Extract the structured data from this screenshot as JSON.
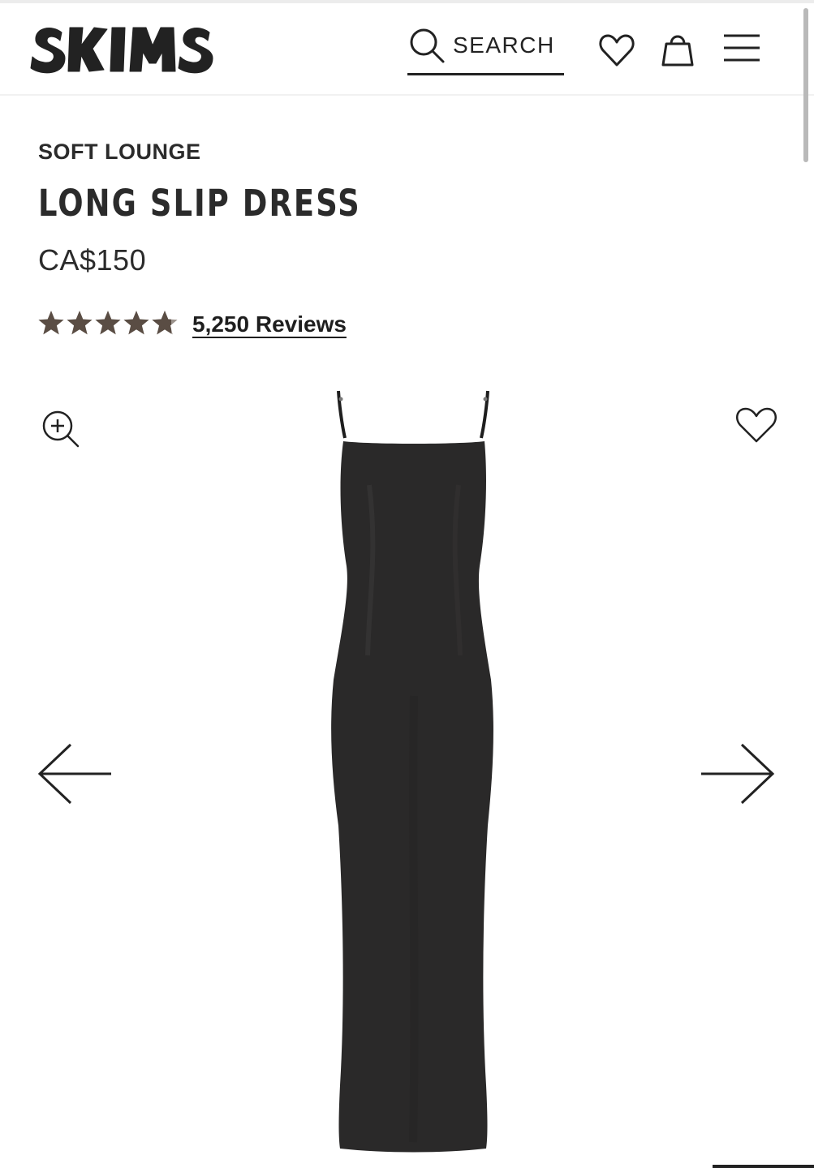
{
  "header": {
    "brand": "SKIMS",
    "search_label": "SEARCH"
  },
  "product": {
    "collection": "SOFT LOUNGE",
    "name": "LONG SLIP DRESS",
    "price": "CA$150",
    "rating": 4.8,
    "rating_max": 5,
    "reviews_label": "5,250 Reviews"
  },
  "colors": {
    "star": "#5a4d44",
    "dress": "#2a2929",
    "text": "#222222"
  },
  "icons": {
    "header": [
      "search-icon",
      "heart-icon",
      "shopping-bag-icon",
      "menu-icon"
    ],
    "gallery": [
      "zoom-in-icon",
      "heart-icon",
      "arrow-left-icon",
      "arrow-right-icon"
    ]
  }
}
